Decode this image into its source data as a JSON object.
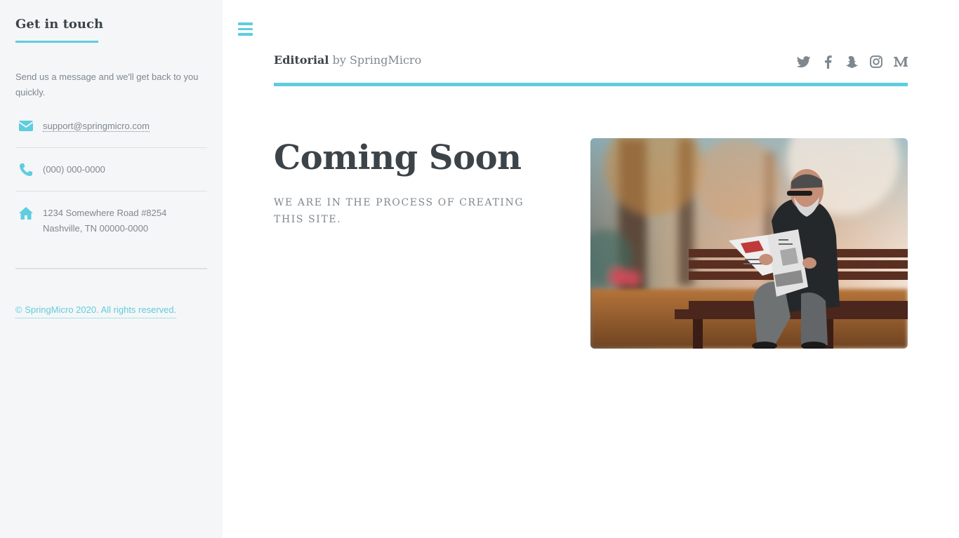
{
  "sidebar": {
    "heading": "Get in touch",
    "intro": "Send us a message and we'll get back to you quickly.",
    "contacts": [
      {
        "icon": "envelope-icon",
        "text": "support@springmicro.com"
      },
      {
        "icon": "phone-icon",
        "text": "(000) 000-0000"
      },
      {
        "icon": "home-icon",
        "line1": "1234 Somewhere Road #8254",
        "line2": "Nashville, TN 00000-0000"
      }
    ],
    "copyright": "© SpringMicro 2020. All rights reserved."
  },
  "header": {
    "logo_bold": "Editorial",
    "logo_rest": " by SpringMicro",
    "social_icons": [
      "twitter-icon",
      "facebook-icon",
      "snapchat-icon",
      "instagram-icon",
      "medium-icon"
    ]
  },
  "main": {
    "title": "Coming Soon",
    "subtitle": "We are in the process of creating this site."
  },
  "colors": {
    "accent": "#5ecde0",
    "text": "#3d4449",
    "muted": "#7f888f",
    "sidebar_bg": "#f5f6f7"
  }
}
